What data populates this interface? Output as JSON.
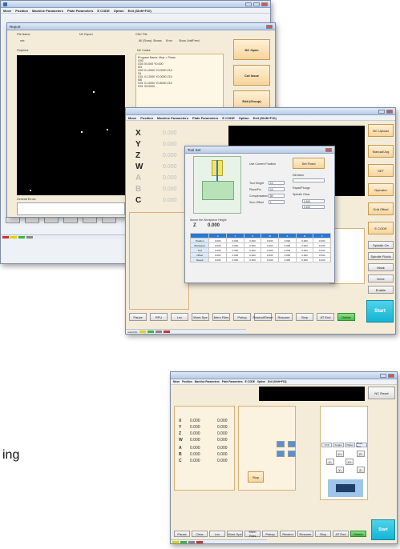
{
  "page": {
    "caption_fragment": "ing"
  },
  "colors": {
    "accent_orange": "#f7d59b",
    "start_teal": "#14b4d6",
    "display_black": "#000000",
    "panel_cream": "#f4ecd9"
  },
  "win_main": {
    "title": "",
    "menu": [
      "Move",
      "Position",
      "Machine Parameters",
      "Plate Parameters",
      "E CODE",
      "Option",
      "Exit (Shift+F10)"
    ]
  },
  "win_report": {
    "title": "Report",
    "labels": {
      "file_name": "File Name:",
      "nc_export": "NC Export",
      "cnc_file": "CNC File",
      "graphics": "Graphics",
      "nc_codes": "NC Codes",
      "general_errors": "General Errors",
      "name_val": "mix"
    },
    "radios": [
      "All (Show)",
      "Shows",
      "Error",
      "Show Unit/Feed"
    ],
    "nc_lines": [
      "Program Name: Mop = Flows",
      "G90",
      "G00 X0.000 Y0.000",
      "M3",
      "G00 X1.0000 Y0.0000 Z10",
      "S4",
      "G01 X1.2000 Y0.0000 Z10",
      "M8",
      "G01 X1.0000 Y0.8000 Z10",
      "G01 X5.0000"
    ],
    "buttons": {
      "nc_open": "NC Open",
      "cut_issue": "Cut Issue",
      "edit_group": "Edit (Group)"
    }
  },
  "win_mid": {
    "menu": [
      "Move",
      "Position",
      "Machine Parameters",
      "Plate Parameters",
      "E CODE",
      "Option",
      "Exit (Shift+F10)"
    ],
    "axes": [
      {
        "name": "X",
        "value": "0.000"
      },
      {
        "name": "Y",
        "value": "0.000"
      },
      {
        "name": "Z",
        "value": "0.000"
      },
      {
        "name": "W",
        "value": "0.000"
      },
      {
        "name": "A",
        "value": "0.000"
      },
      {
        "name": "B",
        "value": "0.000"
      },
      {
        "name": "C",
        "value": "0.000"
      }
    ],
    "side_buttons": [
      "NC Upload",
      "Manual/Jog",
      "SET",
      "Operator",
      "Grid Offset",
      "E CODE",
      "Spindle On",
      "Spindle Fluids",
      "Mask",
      "Drive",
      "Enable"
    ],
    "start_label": "Start",
    "bottom_buttons": [
      "Pause",
      "RFU",
      "Lnc",
      "Work Spe",
      "Mem Files",
      "Pshop",
      "Rewind/Reset",
      "Resume",
      "Stop",
      "AT End",
      "Delete"
    ],
    "status_label": "AutoCNC"
  },
  "dialog": {
    "title": "Tool Set",
    "labels": {
      "use_current": "Use Current Position",
      "set_fixed": "Set Fixed",
      "tool_height": "Tool Height",
      "place_fix": "Place/Fix",
      "comp": "Compensation Sp",
      "zero_dist": "Zero Offset",
      "direction": "Direction",
      "rapid": "Rapid/Plunge",
      "spindle_clear": "Spindle Clear",
      "above": "Above the Workpiece Height",
      "z_axis": "Z",
      "z_val": "0.000"
    },
    "values": {
      "tool_height": "10",
      "place_fix": "10",
      "comp": "50",
      "zero_dist": "1",
      "x": "0.100",
      "y": "0.100"
    },
    "table_head": [
      "",
      "X",
      "Y",
      "Z",
      "W",
      "A",
      "B",
      "C"
    ],
    "table_rows": [
      [
        "Position",
        "0.000",
        "0.000",
        "0.000",
        "0.000",
        "0.000",
        "0.000",
        "0.000"
      ],
      [
        "Workpiece",
        "0.000",
        "0.000",
        "0.000",
        "0.000",
        "0.000",
        "0.000",
        "0.000"
      ],
      [
        "Tool",
        "0.000",
        "0.000",
        "0.000",
        "0.000",
        "0.000",
        "0.000",
        "0.000"
      ],
      [
        "Offset",
        "0.000",
        "0.000",
        "0.000",
        "0.000",
        "0.000",
        "0.000",
        "0.000"
      ],
      [
        "Result",
        "0.000",
        "0.000",
        "0.000",
        "0.000",
        "0.000",
        "0.000",
        "0.000"
      ]
    ]
  },
  "win_bottom": {
    "menu": [
      "Move",
      "Position",
      "Machine Parameters",
      "Plate Parameters",
      "E CODE",
      "Option",
      "Exit (Shift+F10)"
    ],
    "axes": [
      {
        "name": "X",
        "value": "0.000",
        "v2": "0.000"
      },
      {
        "name": "Y",
        "value": "0.000",
        "v2": "0.000"
      },
      {
        "name": "Z",
        "value": "0.000",
        "v2": "0.000"
      },
      {
        "name": "W",
        "value": "0.000",
        "v2": "0.000"
      },
      {
        "name": "A",
        "value": "0.000",
        "v2": "0.000"
      },
      {
        "name": "B",
        "value": "0.000",
        "v2": "0.000"
      },
      {
        "name": "C",
        "value": "0.000",
        "v2": "0.000"
      }
    ],
    "tabs": [
      "XYZ",
      "Angles",
      "Plates",
      "Work Pos"
    ],
    "jog_labels": [
      "Y+",
      "Y-",
      "X-",
      "X+",
      "Z+",
      "Z-"
    ],
    "stop_label": "Stop",
    "start_label": "Start",
    "nc_reset": "NC Reset",
    "bottom_buttons": [
      "Pause",
      "Clear",
      "Lnc",
      "Work Spe",
      "Mem Files",
      "Pshop",
      "Rewind",
      "Resume",
      "Stop",
      "AT End",
      "Delete"
    ]
  }
}
